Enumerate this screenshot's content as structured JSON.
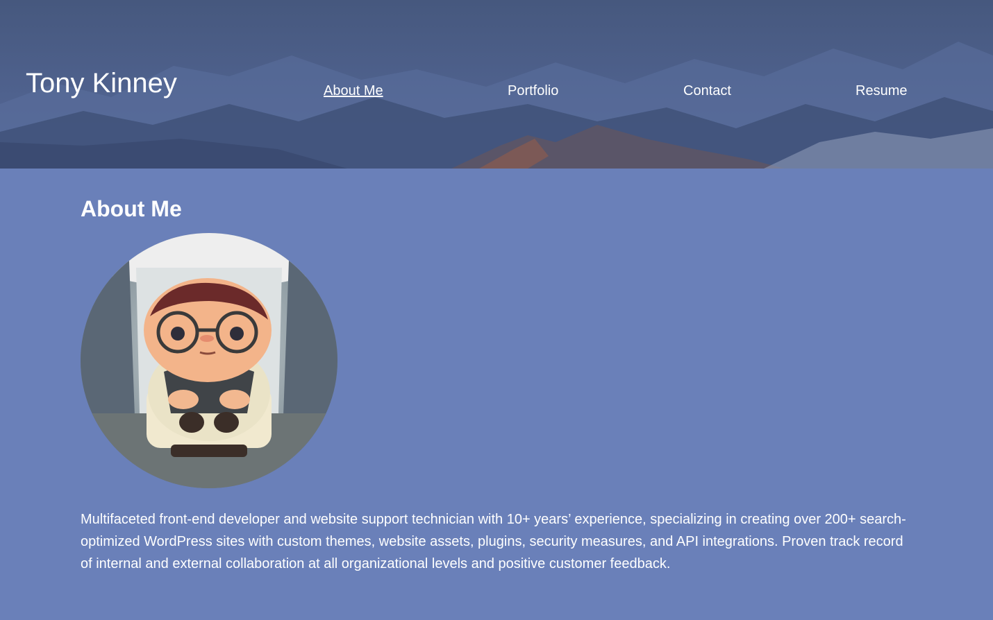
{
  "header": {
    "site_title": "Tony Kinney",
    "nav": [
      {
        "label": "About Me",
        "active": true
      },
      {
        "label": "Portfolio",
        "active": false
      },
      {
        "label": "Contact",
        "active": false
      },
      {
        "label": "Resume",
        "active": false
      }
    ]
  },
  "about": {
    "heading": "About Me",
    "avatar_icon": "profile-avatar-image",
    "bio": "Multifaceted front-end developer and website support technician with 10+ years’ experience, specializing in creating over 200+ search-optimized WordPress sites with custom themes, website assets, plugins, security measures, and API integrations. Proven track record of internal and external collaboration at all organizational levels and positive customer feedback."
  },
  "colors": {
    "page_background": "#6a80b9",
    "header_background": "#4c5f85",
    "text": "#ffffff"
  }
}
